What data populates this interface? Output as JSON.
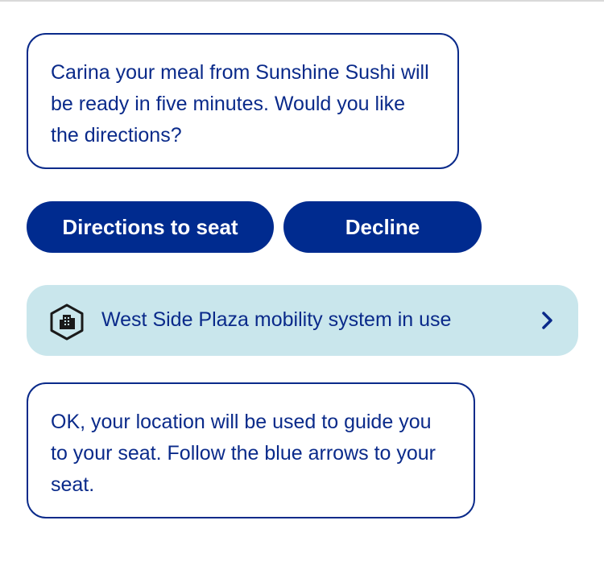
{
  "messages": {
    "meal_ready": "Carina your meal from Sunshine Sushi will be ready in five minutes. Would you like the directions?",
    "location_notice": "OK, your location will be used to guide you to your seat. Follow the blue arrows to your seat."
  },
  "actions": {
    "directions_label": "Directions to seat",
    "decline_label": "Decline"
  },
  "mobility_banner": {
    "text": "West Side Plaza mobility system in use",
    "icon": "building-hexagon-icon",
    "trailing_icon": "chevron-right-icon"
  },
  "colors": {
    "primary": "#002b8f",
    "text": "#0a2a8a",
    "banner_background": "#c9e6ec"
  }
}
